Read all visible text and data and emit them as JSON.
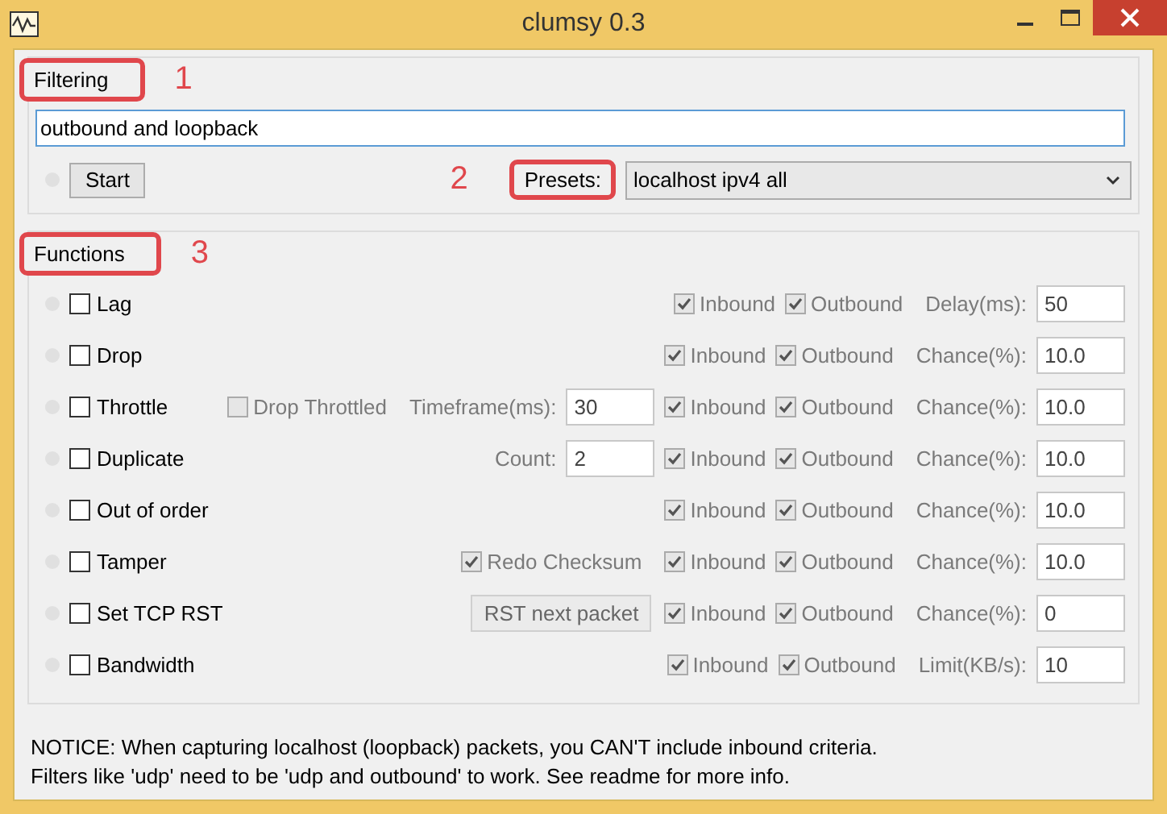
{
  "window": {
    "title": "clumsy 0.3"
  },
  "filtering": {
    "heading": "Filtering",
    "annotation": "1",
    "filter": {
      "value": "outbound and loopback"
    },
    "start_button": "Start",
    "presets": {
      "label": "Presets:",
      "annotation": "2",
      "value": "localhost ipv4 all"
    }
  },
  "functions": {
    "heading": "Functions",
    "annotation": "3",
    "rows": [
      {
        "name": "Lag",
        "checked": false,
        "kind": "plain",
        "inbound": true,
        "inbound_label": "Inbound",
        "outbound": true,
        "outbound_label": "Outbound",
        "param_label": "Delay(ms):",
        "param_value": "50"
      },
      {
        "name": "Drop",
        "checked": false,
        "kind": "plain",
        "inbound": true,
        "inbound_label": "Inbound",
        "outbound": true,
        "outbound_label": "Outbound",
        "param_label": "Chance(%):",
        "param_value": "10.0"
      },
      {
        "name": "Throttle",
        "checked": false,
        "kind": "checkbox_and_field",
        "option_label": "Drop Throttled",
        "option_checked": false,
        "field_label": "Timeframe(ms):",
        "field_value": "30",
        "inbound": true,
        "inbound_label": "Inbound",
        "outbound": true,
        "outbound_label": "Outbound",
        "param_label": "Chance(%):",
        "param_value": "10.0"
      },
      {
        "name": "Duplicate",
        "checked": false,
        "kind": "field",
        "field_label": "Count:",
        "field_value": "2",
        "inbound": true,
        "inbound_label": "Inbound",
        "outbound": true,
        "outbound_label": "Outbound",
        "param_label": "Chance(%):",
        "param_value": "10.0"
      },
      {
        "name": "Out of order",
        "checked": false,
        "kind": "plain",
        "inbound": true,
        "inbound_label": "Inbound",
        "outbound": true,
        "outbound_label": "Outbound",
        "param_label": "Chance(%):",
        "param_value": "10.0"
      },
      {
        "name": "Tamper",
        "checked": false,
        "kind": "checkbox",
        "option_label": "Redo Checksum",
        "option_checked": true,
        "inbound": true,
        "inbound_label": "Inbound",
        "outbound": true,
        "outbound_label": "Outbound",
        "param_label": "Chance(%):",
        "param_value": "10.0"
      },
      {
        "name": "Set TCP RST",
        "checked": false,
        "kind": "button",
        "button_label": "RST next packet",
        "inbound": true,
        "inbound_label": "Inbound",
        "outbound": true,
        "outbound_label": "Outbound",
        "param_label": "Chance(%):",
        "param_value": "0"
      },
      {
        "name": "Bandwidth",
        "checked": false,
        "kind": "plain",
        "inbound": true,
        "inbound_label": "Inbound",
        "outbound": true,
        "outbound_label": "Outbound",
        "param_label": "Limit(KB/s):",
        "param_value": "10"
      }
    ]
  },
  "notice": [
    "NOTICE: When capturing localhost (loopback) packets, you CAN'T include inbound criteria.",
    "Filters like 'udp' need to be 'udp and outbound' to work. See readme for more info."
  ]
}
